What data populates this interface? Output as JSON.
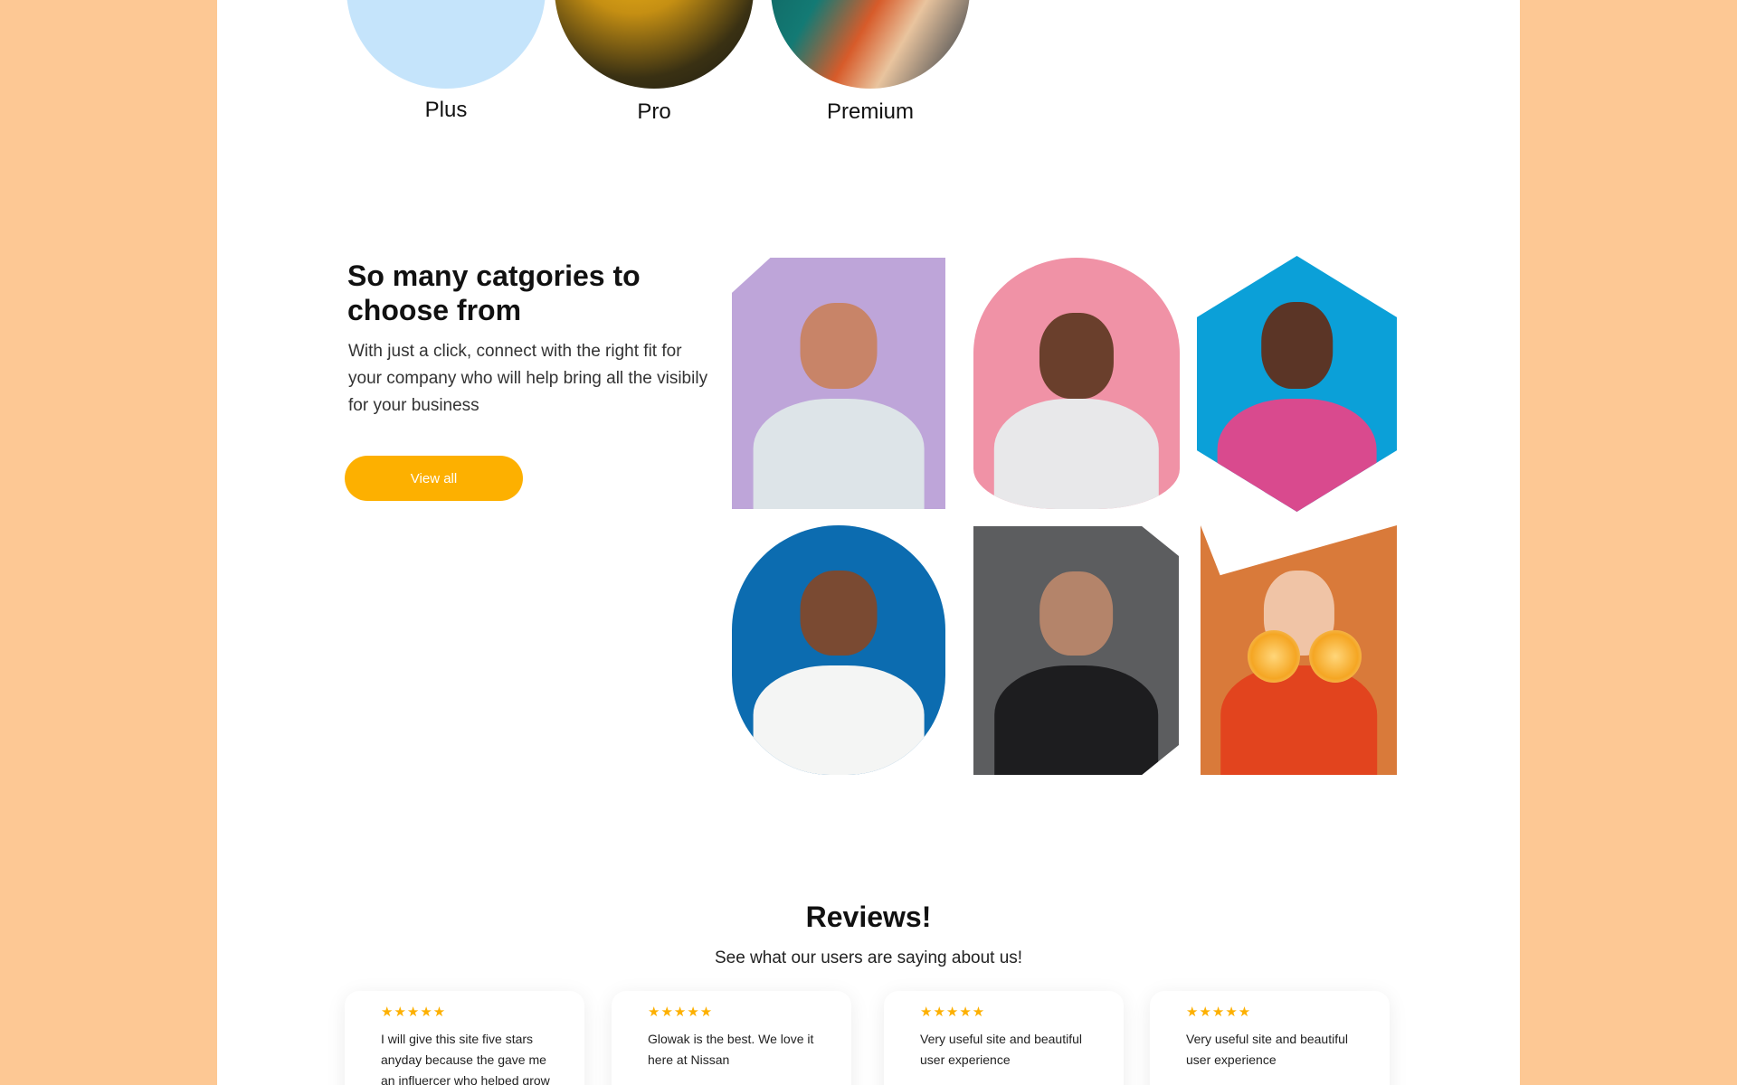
{
  "tiers": [
    {
      "label": "Plus"
    },
    {
      "label": "Pro"
    },
    {
      "label": "Premium"
    }
  ],
  "categories": {
    "title": "So many catgories to choose from",
    "description": "With just a click, connect with the right fit for your company who will help bring all the visibily for your business",
    "button_label": "View all"
  },
  "reviews": {
    "title": "Reviews!",
    "subtitle": "See what our users are saying about us!",
    "cards": [
      {
        "stars": "★★★★★",
        "text": "I will give this site five stars anyday because the gave me an influercer who helped grow my"
      },
      {
        "stars": "★★★★★",
        "text": "Glowak is the best. We love it here at Nissan"
      },
      {
        "stars": "★★★★★",
        "text": "Very useful site and beautiful user experience"
      },
      {
        "stars": "★★★★★",
        "text": "Very useful site and beautiful user experience"
      }
    ]
  },
  "colors": {
    "background": "#fdc894",
    "accent": "#fdb000"
  }
}
